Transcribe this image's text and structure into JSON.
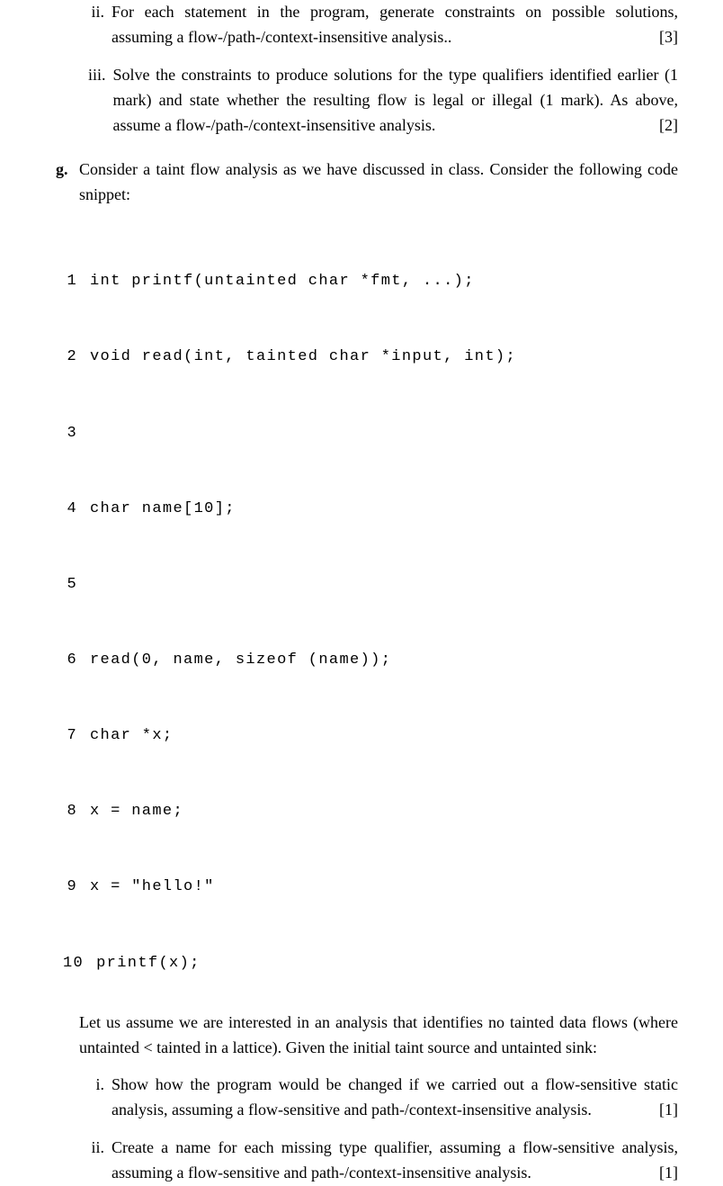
{
  "items": {
    "ii": {
      "label": "ii.",
      "text": "For each statement in the program, generate constraints on possible solutions, assuming a flow-/path-/context-insensitive analysis..",
      "marks": "[3]"
    },
    "iii": {
      "label": "iii.",
      "text": "Solve the constraints to produce solutions for the type qualifiers identified earlier (1 mark) and state whether the resulting flow is legal or illegal (1 mark). As above, assume a flow-/path-/context-insensitive analysis.",
      "marks": "[2]"
    }
  },
  "g": {
    "label": "g.",
    "intro": "Consider a taint flow analysis as we have discussed in class. Consider the following code snippet:",
    "code": [
      {
        "n": "1",
        "t": "int printf(untainted char *fmt, ...);"
      },
      {
        "n": "2",
        "t": "void read(int, tainted char *input, int);"
      },
      {
        "n": "3",
        "t": ""
      },
      {
        "n": "4",
        "t": "char name[10];"
      },
      {
        "n": "5",
        "t": ""
      },
      {
        "n": "6",
        "t": "read(0, name, sizeof (name));"
      },
      {
        "n": "7",
        "t": "char *x;"
      },
      {
        "n": "8",
        "t": "x = name;"
      },
      {
        "n": "9",
        "t": "x = \"hello!\""
      },
      {
        "n": "10",
        "t": "printf(x);"
      }
    ],
    "after": "Let us assume we are interested in an analysis that identifies no tainted data flows (where untainted < tainted in a lattice). Given the initial taint source and untainted sink:",
    "subitems": {
      "i": {
        "label": "i.",
        "text": "Show how the program would be changed if we carried out a flow-sensitive static analysis, assuming a flow-sensitive and path-/context-insensitive analysis.",
        "marks": "[1]"
      },
      "ii": {
        "label": "ii.",
        "text": "Create a name for each missing type qualifier, assuming a flow-sensitive analysis, assuming a flow-sensitive and path-/context-insensitive analysis.",
        "marks": "[1]"
      }
    }
  }
}
